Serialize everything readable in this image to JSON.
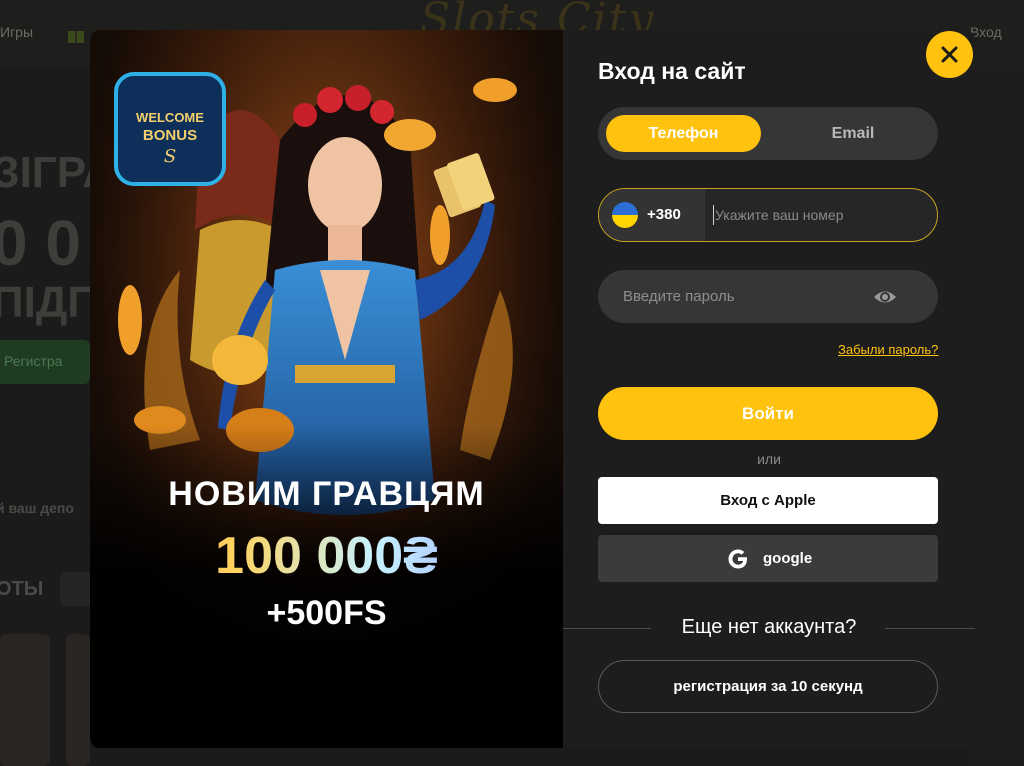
{
  "background": {
    "nav_games": "Игры",
    "login_link": "Вход",
    "promo_title": "ЗІГРА",
    "promo_amount": "0 0",
    "promo_sub": "ПІДП",
    "register_button": "Регистра",
    "deposit_text": "й ваш депо",
    "section_title": "ОТЫ"
  },
  "promo": {
    "badge": "WELCOME BONUS",
    "headline": "НОВИМ ГРАВЦЯМ",
    "amount": "100 000₴",
    "free_spins": "+500FS"
  },
  "login": {
    "title": "Вход на сайт",
    "tabs": [
      {
        "label": "Телефон",
        "active": true
      },
      {
        "label": "Email",
        "active": false
      }
    ],
    "phone": {
      "country_code": "+380",
      "flag": "ukraine-flag-icon",
      "placeholder": "Укажите ваш номер"
    },
    "password": {
      "placeholder": "Введите пароль",
      "toggle_icon": "eye-icon"
    },
    "forgot_password": "Забыли пароль?",
    "submit": "Войти",
    "or": "или",
    "apple_login": "Вход с Apple",
    "google_login": "google",
    "no_account": "Еще нет аккаунта?",
    "register": "регистрация за 10 секунд"
  },
  "colors": {
    "accent": "#ffc20e",
    "panel": "#1d1d1d",
    "field": "#363636"
  }
}
